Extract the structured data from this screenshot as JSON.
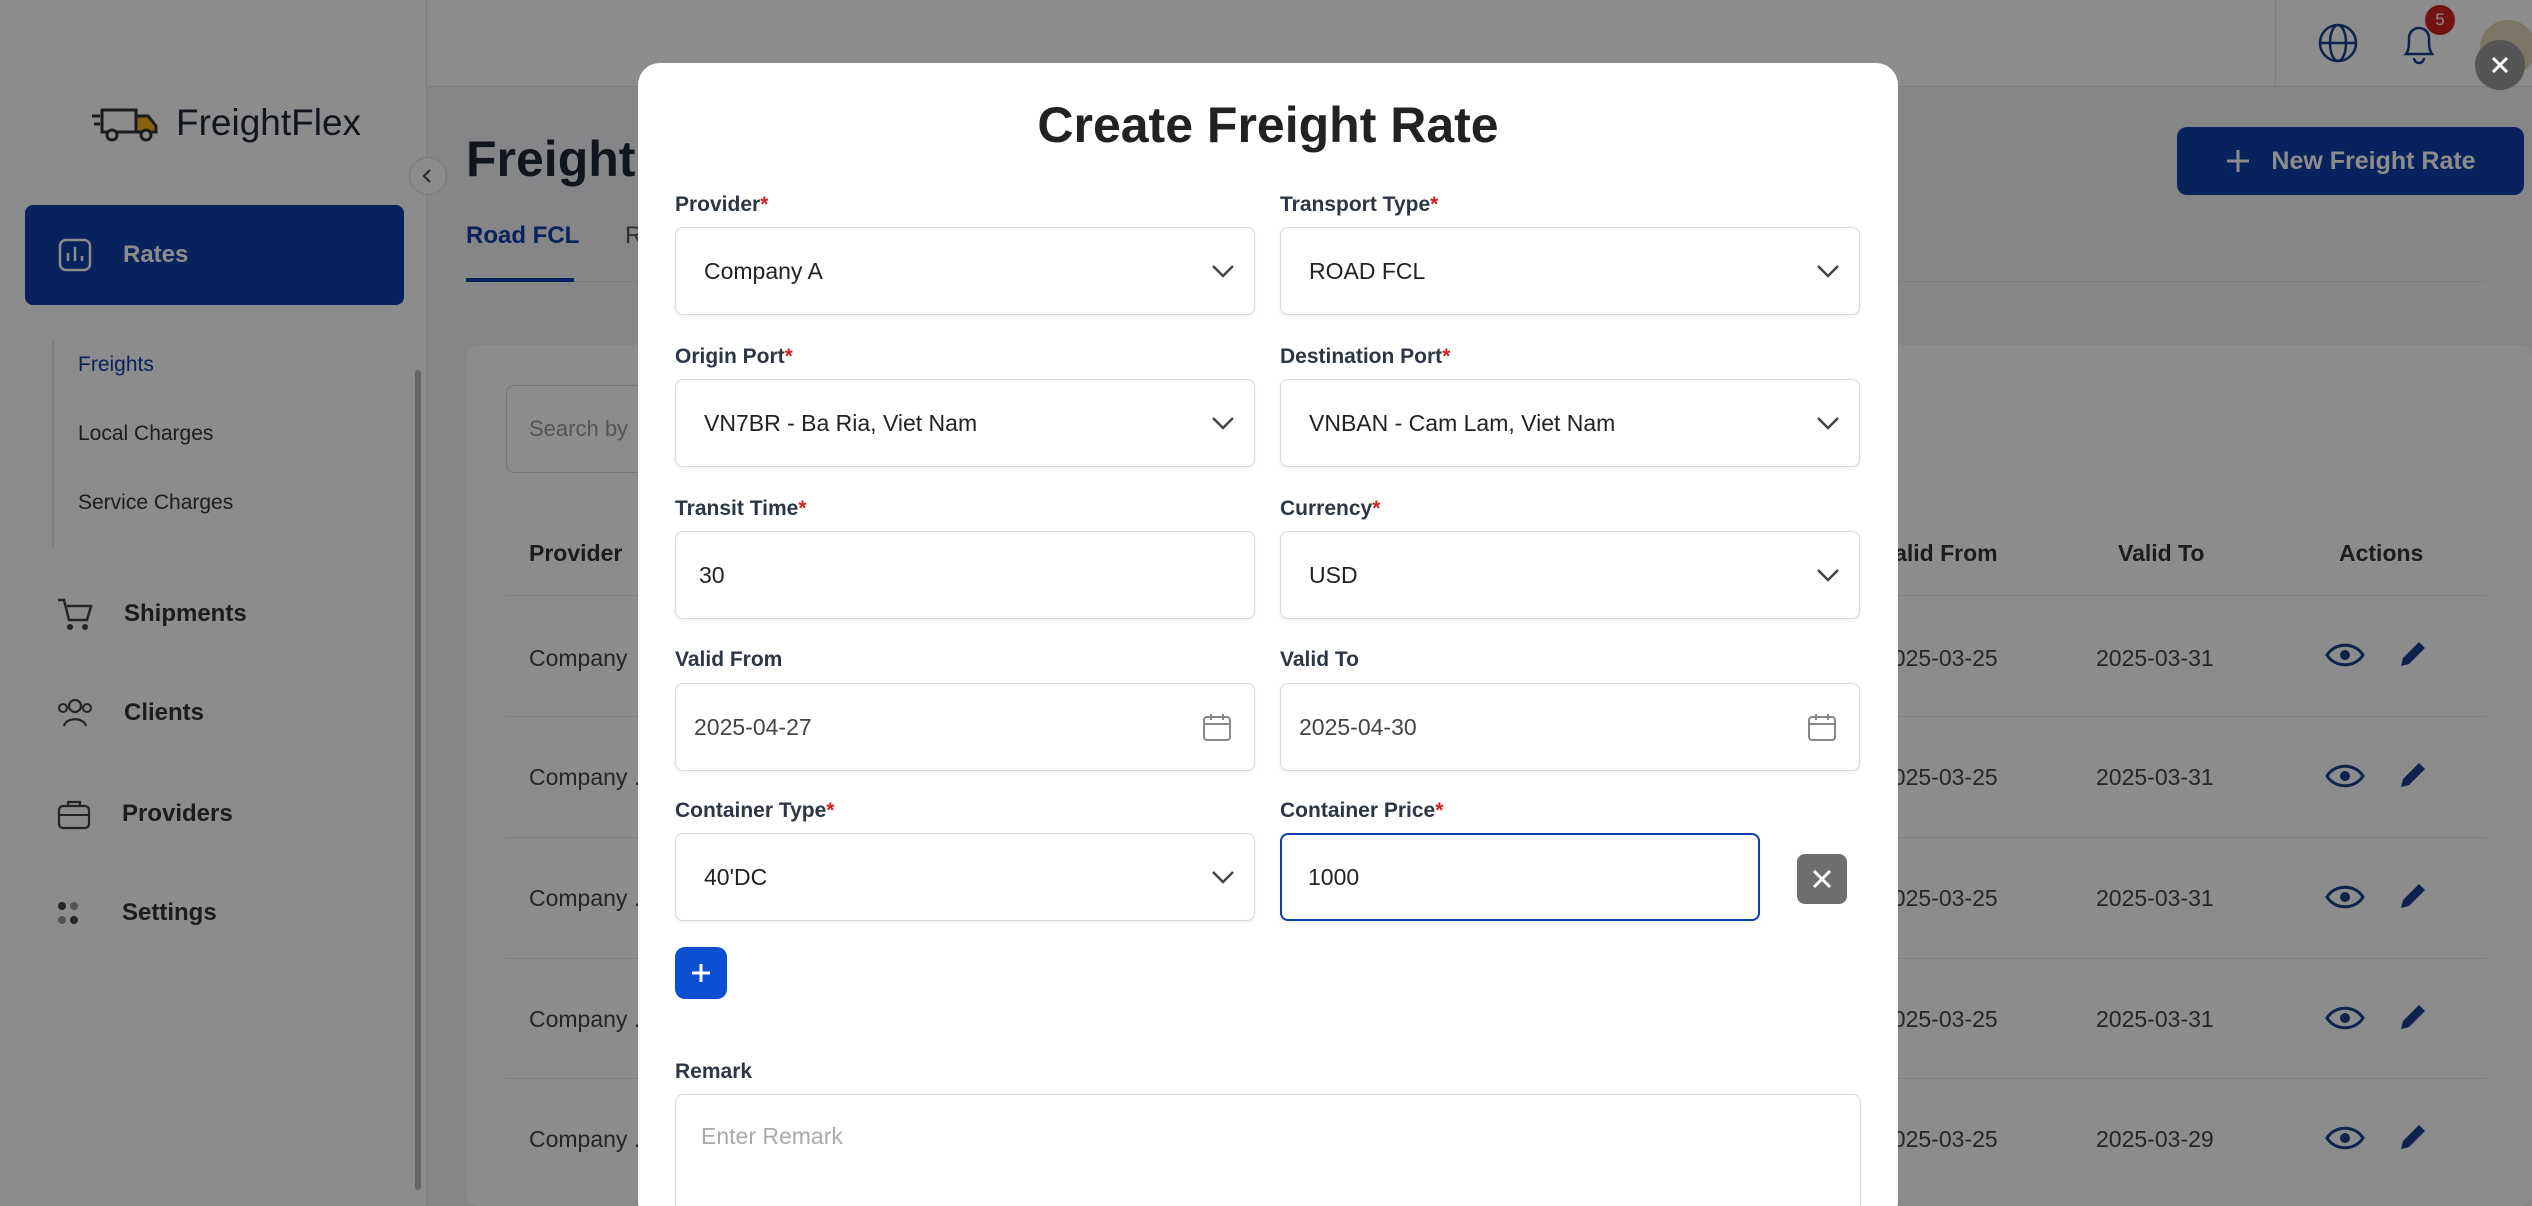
{
  "app": {
    "name": "FreightFlex"
  },
  "sidebar": {
    "active_item": "Rates",
    "sub_items": [
      "Freights",
      "Local Charges",
      "Service Charges"
    ],
    "items": [
      "Shipments",
      "Clients",
      "Providers",
      "Settings"
    ]
  },
  "header": {
    "notification_count": "5"
  },
  "page": {
    "title": "Freight",
    "new_button": "New Freight Rate",
    "tabs": [
      "Road FCL",
      "R"
    ],
    "search_placeholder": "Search by"
  },
  "table": {
    "headers": {
      "provider": "Provider",
      "valid_from": "Valid From",
      "valid_to": "Valid To",
      "actions": "Actions"
    },
    "rows": [
      {
        "provider": "Company",
        "valid_from": "2025-03-25",
        "valid_to": "2025-03-31"
      },
      {
        "provider": "Company .",
        "valid_from": "2025-03-25",
        "valid_to": "2025-03-31"
      },
      {
        "provider": "Company .",
        "valid_from": "2025-03-25",
        "valid_to": "2025-03-31"
      },
      {
        "provider": "Company .",
        "valid_from": "2025-03-25",
        "valid_to": "2025-03-31"
      },
      {
        "provider": "Company .",
        "valid_from": "2025-03-25",
        "valid_to": "2025-03-29"
      }
    ]
  },
  "modal": {
    "title": "Create Freight Rate",
    "provider": {
      "label": "Provider",
      "value": "Company A"
    },
    "transport_type": {
      "label": "Transport Type",
      "value": "ROAD FCL"
    },
    "origin_port": {
      "label": "Origin Port",
      "value": "VN7BR - Ba Ria, Viet Nam"
    },
    "destination_port": {
      "label": "Destination Port",
      "value": "VNBAN - Cam Lam, Viet Nam"
    },
    "transit_time": {
      "label": "Transit Time",
      "value": "30"
    },
    "currency": {
      "label": "Currency",
      "value": "USD"
    },
    "valid_from": {
      "label": "Valid From",
      "value": "2025-04-27"
    },
    "valid_to": {
      "label": "Valid To",
      "value": "2025-04-30"
    },
    "container_type": {
      "label": "Container Type",
      "value": "40'DC"
    },
    "container_price": {
      "label": "Container Price",
      "value": "1000"
    },
    "remark": {
      "label": "Remark",
      "placeholder": "Enter Remark"
    },
    "required_marker": "*"
  }
}
